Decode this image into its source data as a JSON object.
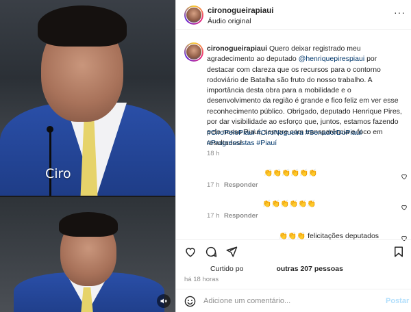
{
  "media": {
    "caption_overlay": "Ciro",
    "mute_icon": "muted-speaker-icon"
  },
  "header": {
    "username": "cironogueirapiaui",
    "audio": "Áudio original",
    "more_icon": "more-dots-icon"
  },
  "post": {
    "username": "cironogueirapiaui",
    "text_before_mention": " Quero deixar registrado meu agradecimento ao deputado ",
    "mention": "@henriquepirespiaui",
    "text_after_mention": " por destacar com clareza que os recursos para o contorno rodoviário de Batalha são fruto do nosso trabalho. A importância desta obra para a mobilidade e o desenvolvimento da região é grande e fico feliz em ver esse reconhecimento público. Obrigado, deputado Henrique Pires, por dar visibilidade ao esforço que, juntos, estamos fazendo pelo nosso Piauí, sempre com transparência e foco em resultados!",
    "hashtags": "#CiroPeloPiauí #CiroNogueira #SenadorDoPiauí #Progressistas #Piauí",
    "time": "18 h"
  },
  "comments": [
    {
      "text": "👏👏👏👏👏👏",
      "time": "17 h",
      "reply": "Responder"
    },
    {
      "text": "👏👏👏👏👏👏",
      "time": "17 h",
      "reply": "Responder"
    },
    {
      "text": "👏👏👏 felicitações deputados",
      "time": "",
      "reply": ""
    }
  ],
  "actions": {
    "like_icon": "heart-icon",
    "comment_icon": "comment-icon",
    "share_icon": "share-icon",
    "save_icon": "bookmark-icon"
  },
  "likes": {
    "prefix": "Curtido po",
    "suffix": "outras 207 pessoas"
  },
  "posted_ago": "há 18 horas",
  "add_comment": {
    "placeholder": "Adicione um comentário...",
    "post_label": "Postar",
    "emoji_icon": "emoji-smile-icon"
  },
  "colors": {
    "link": "#00376b",
    "muted": "#8e8e8e",
    "post_disabled": "#b2dffc"
  }
}
